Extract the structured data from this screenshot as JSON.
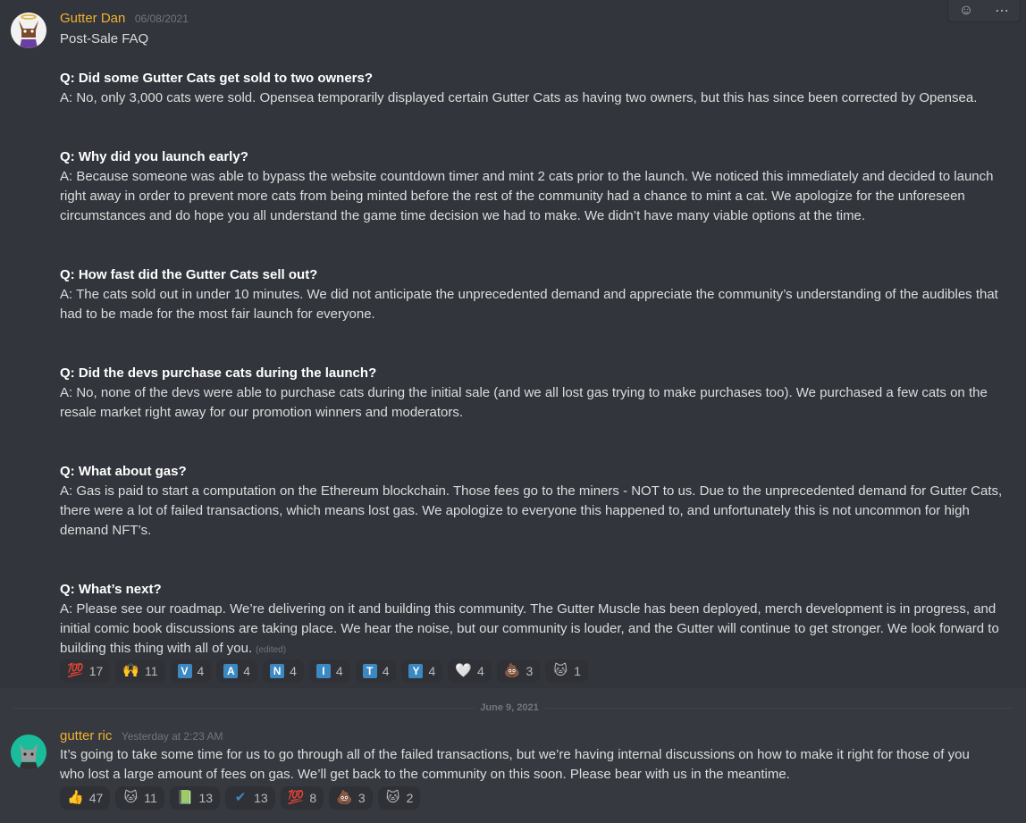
{
  "message1": {
    "author": "Gutter Dan",
    "timestamp": "06/08/2021",
    "title": "Post-Sale FAQ",
    "faq": [
      {
        "q": "Q: Did some Gutter Cats get sold to two owners?",
        "a": "A: No, only 3,000 cats were sold. Opensea temporarily displayed certain Gutter Cats as having two owners, but this has since been corrected by Opensea."
      },
      {
        "q": "Q: Why did you launch early?",
        "a": "A: Because someone was able to bypass the website countdown timer and mint 2 cats prior to the launch. We noticed this immediately and decided to launch right away in order to prevent more cats from being minted before the rest of the community had a chance to mint a cat. We apologize for the unforeseen circumstances and do hope you all understand the game time decision we had to make. We didn’t have many viable options at the time."
      },
      {
        "q": "Q: How fast did the Gutter Cats sell out?",
        "a": "A: The cats sold out in under 10 minutes. We did not anticipate the unprecedented demand and appreciate the community’s understanding of the audibles that had to be made for the most fair launch for everyone."
      },
      {
        "q": "Q: Did the devs purchase cats during the launch?",
        "a": "A: No, none of the devs were able to purchase cats during the initial sale (and we all lost gas trying to make purchases too). We purchased a few cats on the resale market right away for our promotion winners and moderators."
      },
      {
        "q": "Q: What about gas?",
        "a": "A: Gas is paid to start a computation on the Ethereum blockchain. Those fees go to the miners - NOT to us. Due to the unprecedented demand for Gutter Cats, there were a lot of failed transactions, which means lost gas. We apologize to everyone this happened to, and unfortunately this is not uncommon for high demand NFT’s."
      },
      {
        "q": "Q: What’s next?",
        "a": "A: Please see our roadmap. We’re delivering on it and building this community. The Gutter Muscle has been deployed, merch development is in progress, and initial comic book discussions are taking place. We hear the noise, but our community is louder, and the Gutter will continue to get stronger. We look forward to building this thing with all of you."
      }
    ],
    "edited": "(edited)",
    "reactions": [
      {
        "emoji": "💯",
        "kind": "emoji",
        "count": "17"
      },
      {
        "emoji": "🙌",
        "kind": "emoji",
        "count": "11"
      },
      {
        "emoji": "V",
        "kind": "letter",
        "count": "4"
      },
      {
        "emoji": "A",
        "kind": "letter",
        "count": "4"
      },
      {
        "emoji": "N",
        "kind": "letter",
        "count": "4"
      },
      {
        "emoji": "I",
        "kind": "letter",
        "count": "4"
      },
      {
        "emoji": "T",
        "kind": "letter",
        "count": "4"
      },
      {
        "emoji": "Y",
        "kind": "letter",
        "count": "4"
      },
      {
        "emoji": "🤍",
        "kind": "emoji",
        "count": "4"
      },
      {
        "emoji": "💩",
        "kind": "emoji",
        "count": "3"
      },
      {
        "emoji": "🐱",
        "kind": "emoji",
        "count": "1"
      }
    ]
  },
  "divider": {
    "date": "June 9, 2021"
  },
  "message2": {
    "author": "gutter ric",
    "timestamp": "Yesterday at 2:23 AM",
    "text": "It’s going to take some time for us to go through all of the failed transactions, but we’re having internal discussions on how to make it right for those of you who lost a large amount of fees on gas. We’ll get back to the community on this soon. Please bear with us in the meantime.",
    "reactions": [
      {
        "emoji": "👍",
        "kind": "emoji",
        "count": "47"
      },
      {
        "emoji": "🐱",
        "kind": "emoji",
        "count": "11"
      },
      {
        "emoji": "📗",
        "kind": "emoji",
        "count": "13"
      },
      {
        "emoji": "✔",
        "kind": "emoji",
        "count": "13"
      },
      {
        "emoji": "💯",
        "kind": "emoji",
        "count": "8"
      },
      {
        "emoji": "💩",
        "kind": "emoji",
        "count": "3"
      },
      {
        "emoji": "🐱",
        "kind": "emoji",
        "count": "2"
      }
    ]
  },
  "toolbar": {
    "add_reaction_icon": "add-reaction-icon",
    "more_icon": "more-options-icon"
  },
  "colors": {
    "author": "#f0b232",
    "background": "#36393f",
    "highlight": "#32353b",
    "letter_tile": "#3b88c3"
  }
}
